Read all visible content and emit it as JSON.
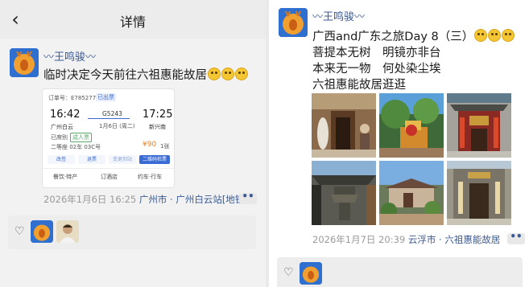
{
  "left": {
    "nav": {
      "back_icon": "chevron-left-icon",
      "title": "详情"
    },
    "post": {
      "user": "〰王鸣骏〰",
      "text": "临时决定今天前往六祖惠能故居",
      "meta_time": "2026年1月6日 16:25",
      "meta_location": "广州市 · 广州白云站[地铁",
      "more": "••"
    },
    "ticket": {
      "order_no": "订单号：E785277865",
      "status": "已出票",
      "depart_time": "16:42",
      "arrive_time": "17:25",
      "train_no": "G5243",
      "date": "1月6日 (周二)",
      "from_station": "广州白云",
      "to_station": "新兴南",
      "passenger": "已席别",
      "tag": "成人票",
      "seat": "二等座 02车 03C号",
      "price": "¥90",
      "price_suffix": "1张",
      "actions": [
        "改签",
        "退票",
        "变更到站",
        "二维码检票"
      ],
      "links": [
        "餐饮·特产",
        "订酒店",
        "约车·行车"
      ]
    },
    "likes": {
      "heart_icon": "heart-icon"
    }
  },
  "right": {
    "post": {
      "user": "〰王鸣骏〰",
      "lines": [
        "广西and广东之旅Day 8（三）",
        "菩提本无树　明镜亦非台",
        "本来无一物　何处染尘埃",
        "六祖惠能故居逛逛"
      ],
      "meta_time": "2026年1月7日 20:39",
      "meta_location": "云浮市 · 六祖惠能故居",
      "more": "••"
    },
    "likes": {
      "heart_icon": "heart-icon"
    }
  }
}
